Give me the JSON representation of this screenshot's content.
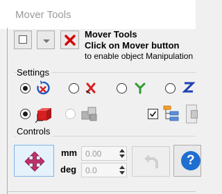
{
  "window": {
    "title": "Mover Tools"
  },
  "header": {
    "title": "Mover Tools",
    "subtitle": "Click on Mover button",
    "hint": "to enable object Manipulation"
  },
  "sections": {
    "settings": "Settings",
    "controls": "Controls"
  },
  "settings": {
    "axis_options": [
      {
        "icon": "rotate-all-icon",
        "checked": true
      },
      {
        "icon": "x-axis-icon",
        "checked": false
      },
      {
        "icon": "y-axis-icon",
        "checked": false
      },
      {
        "icon": "z-axis-icon",
        "checked": false
      }
    ],
    "mode_options": [
      {
        "icon": "red-cube-icon",
        "checked": true,
        "enabled": true
      },
      {
        "icon": "gray-cubes-icon",
        "checked": false,
        "enabled": false
      }
    ],
    "hierarchy_checkbox": {
      "checked": true
    }
  },
  "controls": {
    "mm_label": "mm",
    "mm_value": "0.00",
    "deg_label": "deg",
    "deg_value": "0.0",
    "help_symbol": "?"
  },
  "colors": {
    "close_red": "#d40000",
    "cube_red": "#d62020",
    "help_blue": "#1e6fd0",
    "move_magenta": "#c0306b"
  }
}
